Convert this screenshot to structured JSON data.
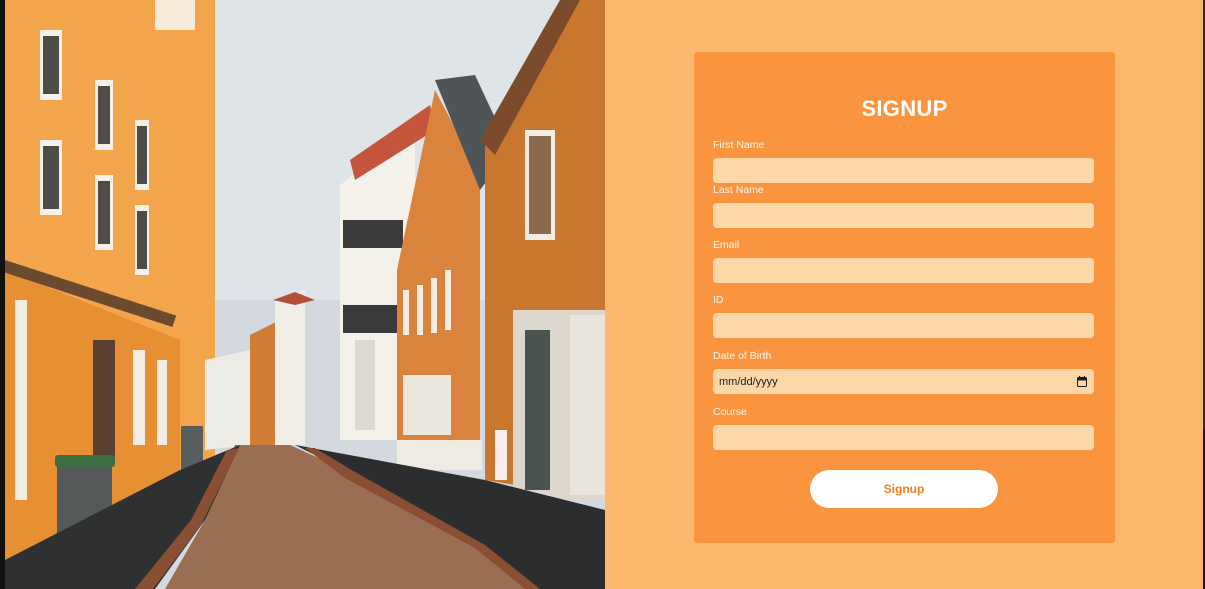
{
  "image": {
    "description_icon": "street-photo"
  },
  "form": {
    "title": "SIGNUP",
    "fields": [
      {
        "label": "First Name",
        "value": ""
      },
      {
        "label": "Last Name",
        "value": ""
      },
      {
        "label": "Email",
        "value": ""
      },
      {
        "label": "ID",
        "value": ""
      },
      {
        "label": "Date of Birth",
        "value": "mm/dd/yyyy"
      },
      {
        "label": "Course",
        "value": ""
      }
    ],
    "button_label": "Signup"
  },
  "colors": {
    "panel_background": "#fdb870",
    "card_background": "#fb943e",
    "input_background": "#fdd7a8",
    "button_background": "#ffffff",
    "button_text": "#f07f23"
  }
}
